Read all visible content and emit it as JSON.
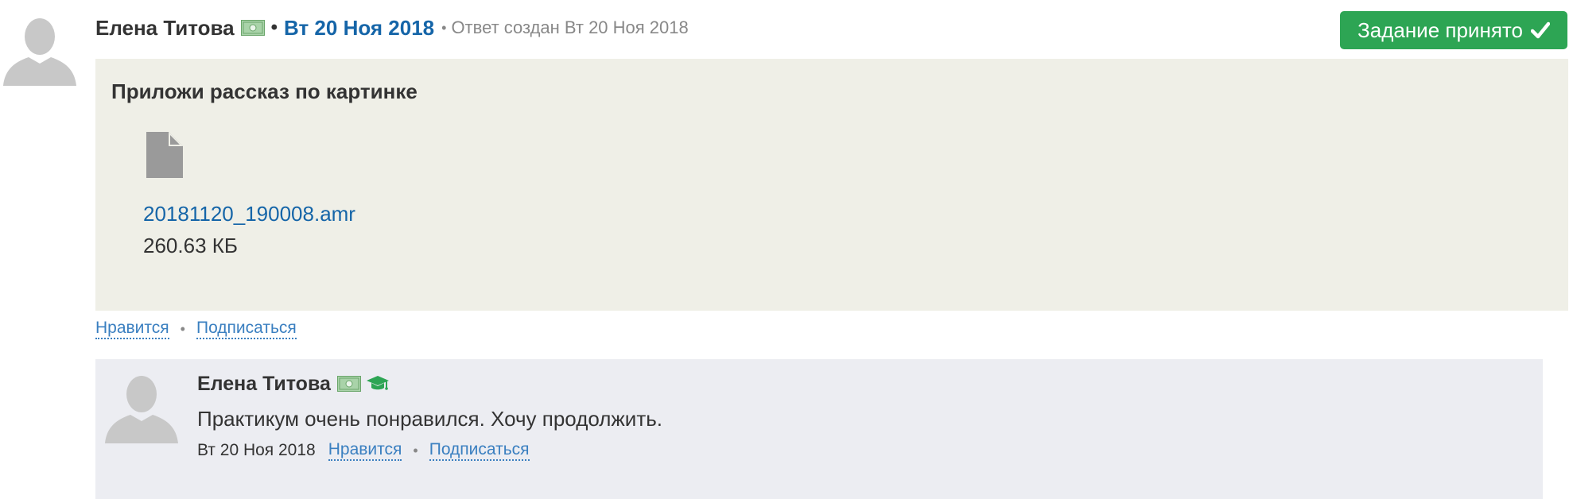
{
  "post": {
    "author": "Елена Титова",
    "date": "Вт 20 Ноя 2018",
    "meta": "Ответ создан Вт 20 Ноя 2018",
    "separator_big": "•",
    "separator_small": "•",
    "status_button": "Задание принято",
    "task": {
      "title": "Приложи рассказ по картинке",
      "attachment": {
        "file_name": "20181120_190008.amr",
        "file_size": "260.63 КБ",
        "icon": "file-icon"
      }
    },
    "actions": {
      "like": "Нравится",
      "separator": "•",
      "subscribe": "Подписаться"
    }
  },
  "comment": {
    "author": "Елена Титова",
    "text": "Практикум очень понравился. Хочу продолжить.",
    "date": "Вт 20 Ноя 2018",
    "actions": {
      "like": "Нравится",
      "separator": "•",
      "subscribe": "Подписаться"
    },
    "icons": [
      "money-icon",
      "graduation-cap-icon"
    ]
  },
  "colors": {
    "accent_blue": "#1565a8",
    "link_blue": "#3a7fc0",
    "success_green": "#2da554",
    "task_bg": "#efefe7",
    "comment_bg": "#ecedf2",
    "avatar_gray": "#c8c8c8"
  }
}
